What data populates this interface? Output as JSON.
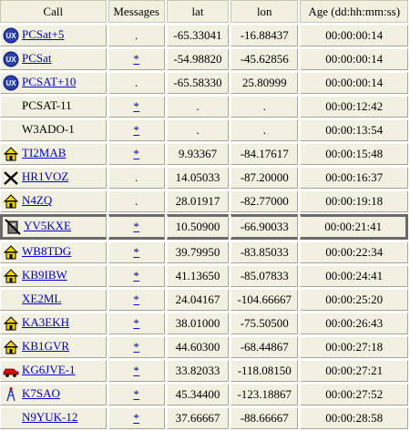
{
  "headers": [
    "Call",
    "Messages",
    "lat",
    "lon",
    "Age (dd:hh:mm:ss)"
  ],
  "rows": [
    {
      "call": "PCSat+5",
      "linked": true,
      "icon": "ux-badge-icon",
      "msg": ".",
      "msg_link": false,
      "lat": "-65.33041",
      "lon": "-16.88437",
      "age": "00:00:00:14"
    },
    {
      "call": "PCSat",
      "linked": true,
      "icon": "ux-badge-icon",
      "msg": "*",
      "msg_link": true,
      "lat": "-54.98820",
      "lon": "-45.62856",
      "age": "00:00:00:14"
    },
    {
      "call": "PCSAT+10",
      "linked": true,
      "icon": "ux-badge-icon",
      "msg": ".",
      "msg_link": false,
      "lat": "-65.58330",
      "lon": "25.80999",
      "age": "00:00:00:14"
    },
    {
      "call": "PCSAT-11",
      "linked": false,
      "icon": "",
      "msg": "*",
      "msg_link": true,
      "lat": ".",
      "lon": ".",
      "age": "00:00:12:42"
    },
    {
      "call": "W3ADO-1",
      "linked": false,
      "icon": "",
      "msg": "*",
      "msg_link": true,
      "lat": ".",
      "lon": ".",
      "age": "00:00:13:54"
    },
    {
      "call": "TI2MAB",
      "linked": true,
      "icon": "house-icon",
      "msg": "*",
      "msg_link": true,
      "lat": "9.93367",
      "lon": "-84.17617",
      "age": "00:00:15:48"
    },
    {
      "call": "HR1VOZ",
      "linked": true,
      "icon": "cross-icon",
      "msg": ".",
      "msg_link": false,
      "lat": "14.05033",
      "lon": "-87.20000",
      "age": "00:00:16:37"
    },
    {
      "call": "N4ZQ",
      "linked": true,
      "icon": "house-icon",
      "msg": ".",
      "msg_link": false,
      "lat": "28.01917",
      "lon": "-82.77000",
      "age": "00:00:19:18"
    },
    {
      "call": "YV5KXE",
      "linked": true,
      "icon": "no-phone-icon",
      "msg": "*",
      "msg_link": true,
      "lat": "10.50900",
      "lon": "-66.90033",
      "age": "00:00:21:41",
      "highlight": true
    },
    {
      "call": "WB8TDG",
      "linked": true,
      "icon": "house-icon",
      "msg": "*",
      "msg_link": true,
      "lat": "39.79950",
      "lon": "-83.85033",
      "age": "00:00:22:34"
    },
    {
      "call": "KB9IBW",
      "linked": true,
      "icon": "house-icon",
      "msg": "*",
      "msg_link": true,
      "lat": "41.13650",
      "lon": "-85.07833",
      "age": "00:00:24:41"
    },
    {
      "call": "XE2ML",
      "linked": true,
      "icon": "",
      "msg": "*",
      "msg_link": true,
      "lat": "24.04167",
      "lon": "-104.66667",
      "age": "00:00:25:20"
    },
    {
      "call": "KA3EKH",
      "linked": true,
      "icon": "house-icon",
      "msg": "*",
      "msg_link": true,
      "lat": "38.01000",
      "lon": "-75.50500",
      "age": "00:00:26:43"
    },
    {
      "call": "KB1GVR",
      "linked": true,
      "icon": "house-icon",
      "msg": "*",
      "msg_link": true,
      "lat": "44.60300",
      "lon": "-68.44867",
      "age": "00:00:27:18"
    },
    {
      "call": "KG6JVE-1",
      "linked": true,
      "icon": "car-icon",
      "msg": "*",
      "msg_link": true,
      "lat": "33.82033",
      "lon": "-118.08150",
      "age": "00:00:27:21"
    },
    {
      "call": "K7SAO",
      "linked": true,
      "icon": "tower-icon",
      "msg": "*",
      "msg_link": true,
      "lat": "45.34400",
      "lon": "-123.18867",
      "age": "00:00:27:52"
    },
    {
      "call": "N9YUK-12",
      "linked": true,
      "icon": "",
      "msg": "*",
      "msg_link": true,
      "lat": "37.66667",
      "lon": "-88.66667",
      "age": "00:00:28:58"
    }
  ]
}
